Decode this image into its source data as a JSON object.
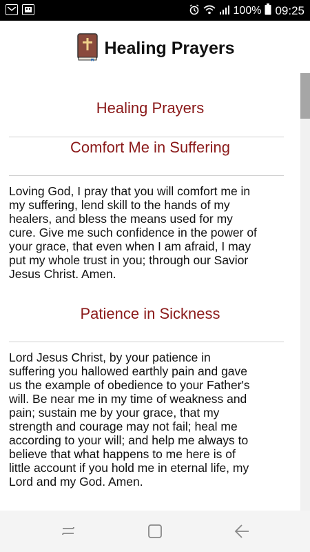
{
  "status_bar": {
    "left_icons": [
      "mail-icon",
      "app-icon"
    ],
    "right_icons": [
      "alarm-icon",
      "wifi-icon",
      "signal-icon"
    ],
    "battery": "100%",
    "time": "09:25"
  },
  "header": {
    "logo_icon": "bible-icon",
    "title": "Healing Prayers"
  },
  "content": {
    "page_title": "Healing Prayers",
    "sections": [
      {
        "title": "Comfort Me in Suffering",
        "lines": [
          "Loving God, I pray that you will comfort me in",
          "my suffering, lend skill to the hands of my",
          "healers, and bless the means used for my",
          "cure. Give me such confidence in the power of",
          "your grace, that even when I am afraid, I may",
          "put my whole trust in you; through our Savior",
          "Jesus Christ. Amen."
        ]
      },
      {
        "title": "Patience in Sickness",
        "lines": [
          "Lord Jesus Christ, by your patience in",
          "suffering you hallowed earthly pain and gave",
          "us the example of obedience to your Father's",
          "will. Be near me in my time of weakness and",
          "pain; sustain me by your grace, that my",
          "strength and courage may not fail; heal me",
          "according to your will; and help me always to",
          "believe that what happens to me here is of",
          "little account if you hold me in eternal life, my",
          "Lord and my God. Amen."
        ]
      }
    ]
  },
  "nav_bar": {
    "buttons": [
      "recent-apps-icon",
      "home-icon",
      "back-icon"
    ]
  }
}
